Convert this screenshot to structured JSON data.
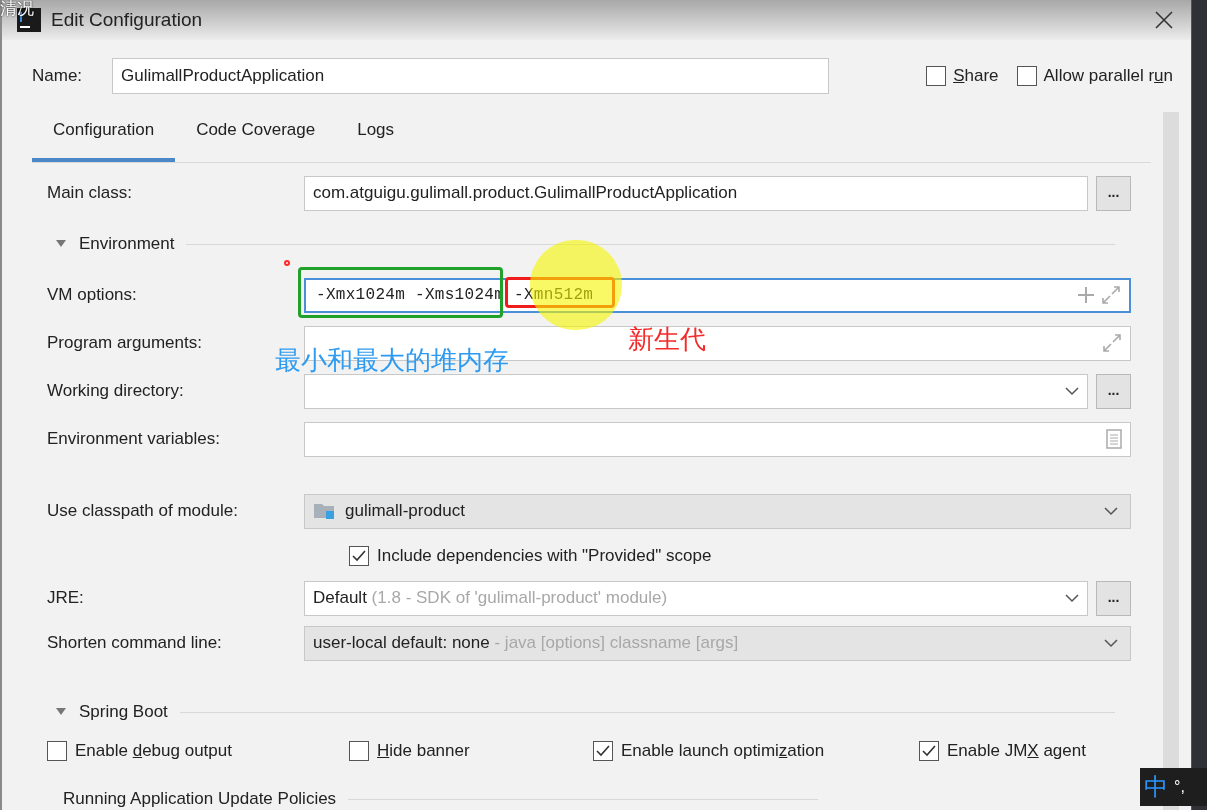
{
  "overlay_text": "清况",
  "window": {
    "title": "Edit Configuration"
  },
  "name": {
    "label": "Name:",
    "value": "GulimallProductApplication"
  },
  "options": [
    {
      "label": {
        "key": "S",
        "after": "hare"
      },
      "checked": false
    },
    {
      "label": {
        "before": "Allow parallel r",
        "key": "u",
        "after": "n"
      },
      "checked": false
    }
  ],
  "tabs": [
    {
      "label": "Configuration",
      "selected": true
    },
    {
      "label": "Code Coverage",
      "selected": false
    },
    {
      "label": "Logs",
      "selected": false
    }
  ],
  "rows": [
    {
      "kind": "text",
      "label": "Main class:",
      "value": "com.atguigu.gulimall.product.GulimallProductApplication",
      "browse": "..."
    },
    {
      "kind": "section",
      "label": "Environment",
      "expanded": true
    },
    {
      "kind": "options",
      "label": "VM options:",
      "value": "-Xmx1024m -Xms1024m -Xmn512m",
      "focused": true
    },
    {
      "kind": "expandable",
      "label": "Program arguments:",
      "focused": false
    },
    {
      "kind": "combo",
      "label": "Working directory:",
      "browse": "..."
    },
    {
      "kind": "envvars",
      "label": "Environment variables:"
    },
    {
      "kind": "module",
      "label": "Use classpath of module:",
      "value": "gulimall-product"
    },
    {
      "kind": "checkbox",
      "label": "Include dependencies with \"Provided\" scope",
      "checked": true
    },
    {
      "kind": "combo",
      "label": "JRE:",
      "value": "Default",
      "hint": "(1.8 - SDK of 'gulimall-product' module)",
      "browse": "..."
    },
    {
      "kind": "dropdown",
      "label": "Shorten command line:",
      "value": "user-local default: none",
      "hint": "- java [options] classname [args]"
    },
    {
      "kind": "section",
      "label": "Spring Boot",
      "expanded": true
    },
    {
      "kind": "checks",
      "items": [
        {
          "label": {
            "before": "Enable ",
            "key": "d",
            "after": "ebug output"
          },
          "checked": false
        },
        {
          "label": {
            "key": "H",
            "after": "ide banner"
          },
          "checked": false
        },
        {
          "label": {
            "before": "Enable launch optimi",
            "key": "z",
            "after": "ation"
          },
          "checked": true
        },
        {
          "label": {
            "before": "Enable JM",
            "key": "X",
            "after": " agent"
          },
          "checked": true
        }
      ]
    },
    {
      "kind": "group",
      "label": "Running Application Update Policies"
    }
  ],
  "annotations": [
    {
      "kind": "box",
      "color": "#1fa12a"
    },
    {
      "kind": "box",
      "color": "#f01c1c"
    },
    {
      "kind": "spotlight"
    },
    {
      "kind": "dot",
      "color": "#ff2a2a"
    },
    {
      "kind": "note",
      "text": "最小和最大的堆内存",
      "color": "#2f9bf0"
    },
    {
      "kind": "note",
      "text": "新生代",
      "color": "#f52a2a"
    }
  ],
  "ime": {
    "mode": "中",
    "punct": "°,"
  }
}
